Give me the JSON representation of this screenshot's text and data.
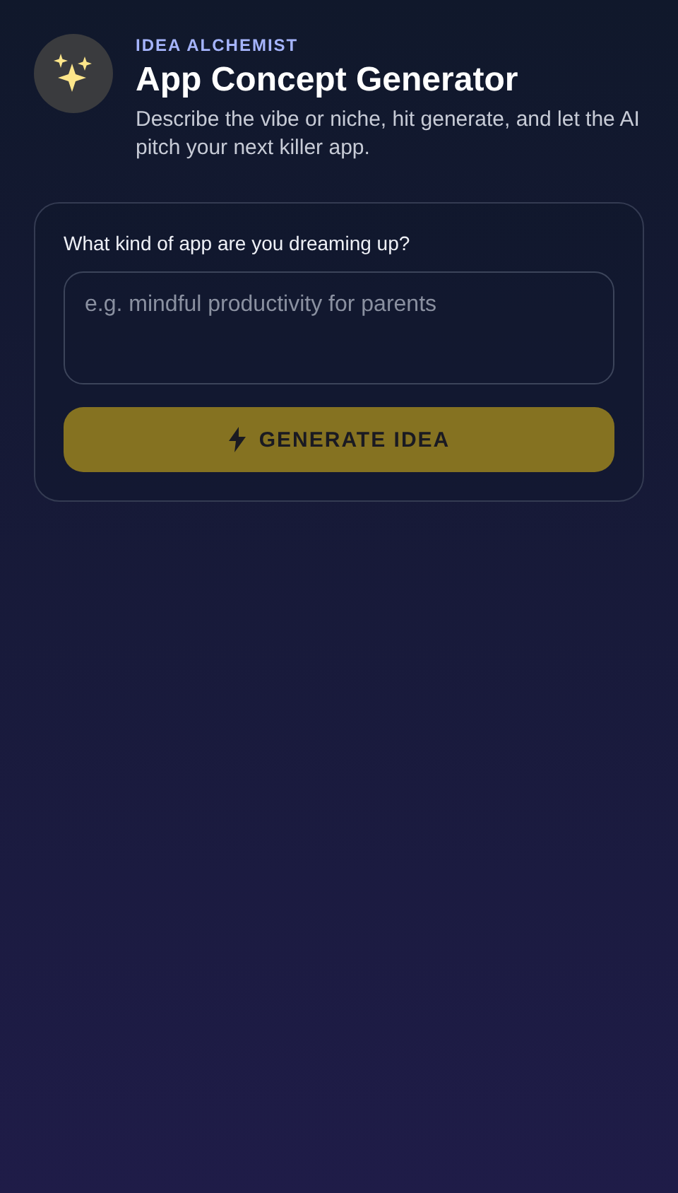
{
  "header": {
    "eyebrow": "IDEA ALCHEMIST",
    "title": "App Concept Generator",
    "subtitle": "Describe the vibe or niche, hit generate, and let the AI pitch your next killer app."
  },
  "form": {
    "label": "What kind of app are you dreaming up?",
    "placeholder": "e.g. mindful productivity for parents",
    "button": {
      "label": "GENERATE IDEA",
      "disabled": true
    }
  }
}
